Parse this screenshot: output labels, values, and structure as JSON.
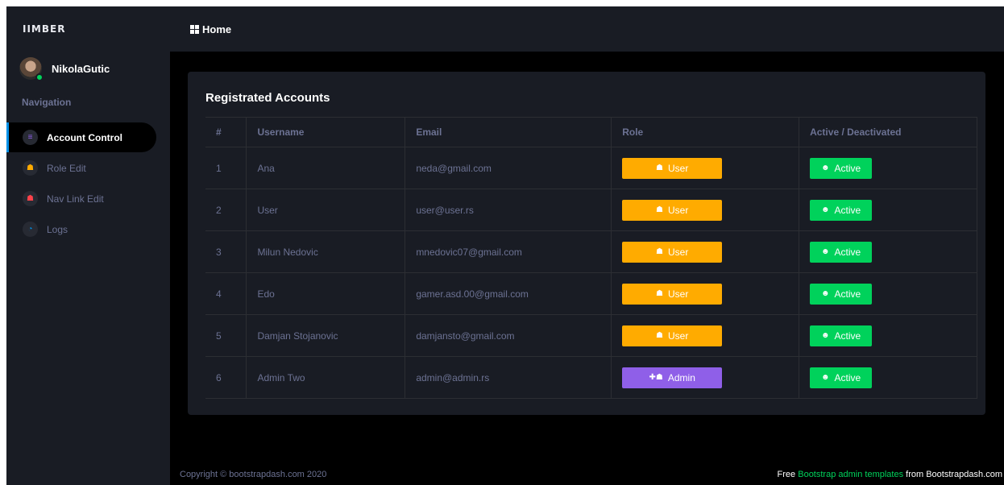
{
  "app": {
    "logo": "IIMBER"
  },
  "header": {
    "icon": "grid-icon",
    "title": "Home"
  },
  "sidebar": {
    "profile_name": "NikolaGutic",
    "nav_heading": "Navigation",
    "items": [
      {
        "label": "Account Control",
        "icon": "list-icon",
        "icon_color": "#8f5fe8",
        "glyph": "≡",
        "active": true
      },
      {
        "label": "Role Edit",
        "icon": "role-icon",
        "icon_color": "#ffab00",
        "glyph": "☗",
        "active": false
      },
      {
        "label": "Nav Link Edit",
        "icon": "link-icon",
        "icon_color": "#fc424a",
        "glyph": "☗",
        "active": false
      },
      {
        "label": "Logs",
        "icon": "gauge-icon",
        "icon_color": "#0090e7",
        "glyph": "◔",
        "active": false
      }
    ]
  },
  "card": {
    "title": "Registrated Accounts",
    "columns": [
      "#",
      "Username",
      "Email",
      "Role",
      "Active / Deactivated"
    ],
    "rows": [
      {
        "num": "1",
        "username": "Ana",
        "email": "neda@gmail.com",
        "role": "User",
        "status": "Active"
      },
      {
        "num": "2",
        "username": "User",
        "email": "user@user.rs",
        "role": "User",
        "status": "Active"
      },
      {
        "num": "3",
        "username": "Milun Nedovic",
        "email": "mnedovic07@gmail.com",
        "role": "User",
        "status": "Active"
      },
      {
        "num": "4",
        "username": "Edo",
        "email": "gamer.asd.00@gmail.com",
        "role": "User",
        "status": "Active"
      },
      {
        "num": "5",
        "username": "Damjan Stojanovic",
        "email": "damjansto@gmail.com",
        "role": "User",
        "status": "Active"
      },
      {
        "num": "6",
        "username": "Admin Two",
        "email": "admin@admin.rs",
        "role": "Admin",
        "status": "Active"
      }
    ]
  },
  "footer": {
    "copyright": "Copyright © bootstrapdash.com 2020",
    "free_prefix": "Free",
    "free_link": "Bootstrap admin templates",
    "free_suffix": "from Bootstrapdash.com"
  },
  "colors": {
    "user_role": "#ffab00",
    "admin_role": "#8f5fe8",
    "active": "#00d25b",
    "accent": "#0090e7"
  }
}
